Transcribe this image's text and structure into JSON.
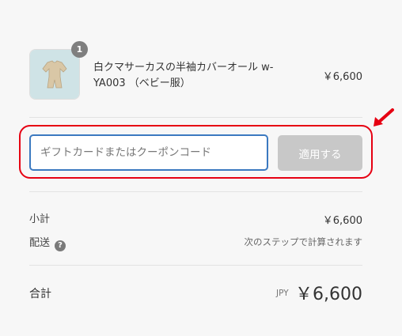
{
  "cart_item": {
    "quantity": "1",
    "name": "白クマサーカスの半袖カバーオール w-YA003 （ベビー服）",
    "price": "￥6,600"
  },
  "discount": {
    "placeholder": "ギフトカードまたはクーポンコード",
    "apply_label": "適用する"
  },
  "summary": {
    "subtotal_label": "小計",
    "subtotal_value": "￥6,600",
    "shipping_label": "配送",
    "shipping_help_icon": "?",
    "shipping_note": "次のステップで計算されます",
    "total_label": "合計",
    "currency": "JPY",
    "total_value": "￥6,600"
  },
  "colors": {
    "highlight": "#e60012",
    "input_focus": "#3b79c0",
    "button_disabled": "#c8c8c8"
  }
}
